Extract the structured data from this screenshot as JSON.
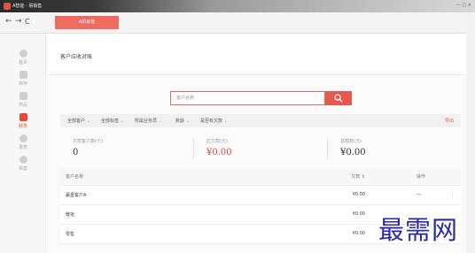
{
  "window": {
    "app_title": "A智能 · 易销售",
    "controls": "— □ ×"
  },
  "nav": {
    "back": "←",
    "forward": "→",
    "reload": "C",
    "tab_label": "A的标签"
  },
  "sidebar": {
    "items": [
      {
        "label": "首页",
        "icon": "home-icon"
      },
      {
        "label": "库存",
        "icon": "warehouse-icon"
      },
      {
        "label": "商品",
        "icon": "goods-icon"
      },
      {
        "label": "财务",
        "icon": "finance-icon",
        "active": true
      },
      {
        "label": "报表",
        "icon": "report-icon"
      },
      {
        "label": "档案",
        "icon": "archive-icon"
      }
    ]
  },
  "page": {
    "title": "客户应收对账"
  },
  "search": {
    "placeholder": "客户名称"
  },
  "filters": {
    "items": [
      "全部客户",
      "全部标签",
      "所属业务员",
      "账龄",
      "是否有欠款"
    ],
    "export": "导出"
  },
  "stats": [
    {
      "label": "欠款客户数(个)",
      "value": "0"
    },
    {
      "label": "应欠款(元)",
      "value": "¥0.00"
    },
    {
      "label": "总额款(元)",
      "value": "¥0.00"
    }
  ],
  "table": {
    "headers": {
      "name": "客户名称",
      "amount": "欠款 ⇕",
      "op": "操作"
    },
    "rows": [
      {
        "name": "赢金客户A",
        "amount": "¥0.00",
        "op": "—",
        "more": "⋮"
      },
      {
        "name": "散批",
        "amount": "¥0.00",
        "op": "",
        "more": ""
      },
      {
        "name": "零售",
        "amount": "¥0.00",
        "op": "",
        "more": ""
      }
    ]
  },
  "watermark": "最需网",
  "colors": {
    "accent": "#e8574a",
    "active": "#e8483b",
    "watermark": "#2a2aa8"
  }
}
